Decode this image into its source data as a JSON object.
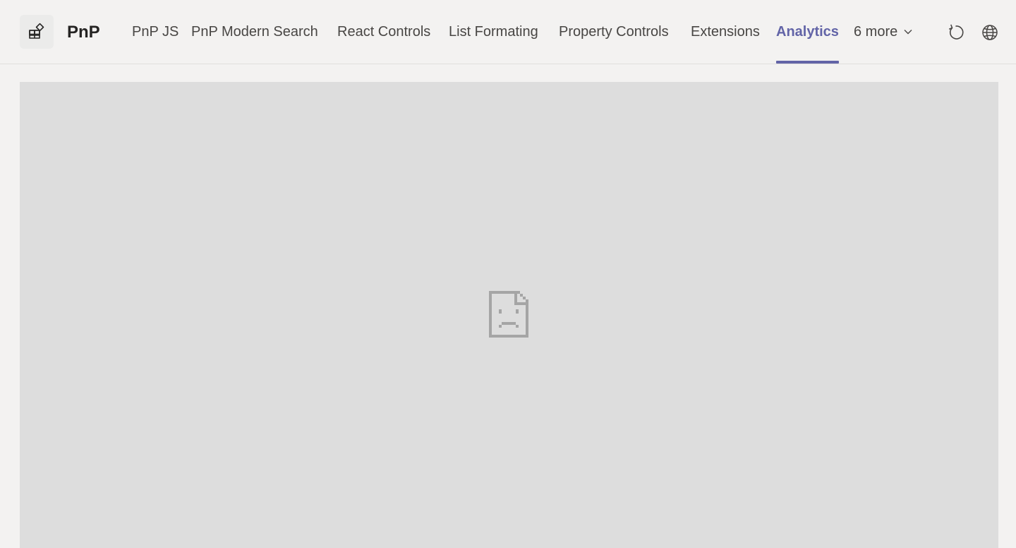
{
  "app": {
    "title": "PnP",
    "icon": "apps-icon"
  },
  "tabs": [
    {
      "label": "PnP JS",
      "active": false
    },
    {
      "label": "PnP Modern Search",
      "active": false
    },
    {
      "label": "React Controls",
      "active": false
    },
    {
      "label": "List Formating",
      "active": false
    },
    {
      "label": "Property Controls",
      "active": false
    },
    {
      "label": "Extensions",
      "active": false
    },
    {
      "label": "Analytics",
      "active": true
    },
    {
      "label": "6 more",
      "active": false
    }
  ],
  "actions": {
    "reload_icon": "reload-icon",
    "globe_icon": "globe-icon"
  },
  "content": {
    "state_icon": "broken-document-icon"
  },
  "colors": {
    "accent": "#6264a7",
    "background": "#f3f2f1",
    "frame": "#dddddd",
    "text": "#484644"
  }
}
